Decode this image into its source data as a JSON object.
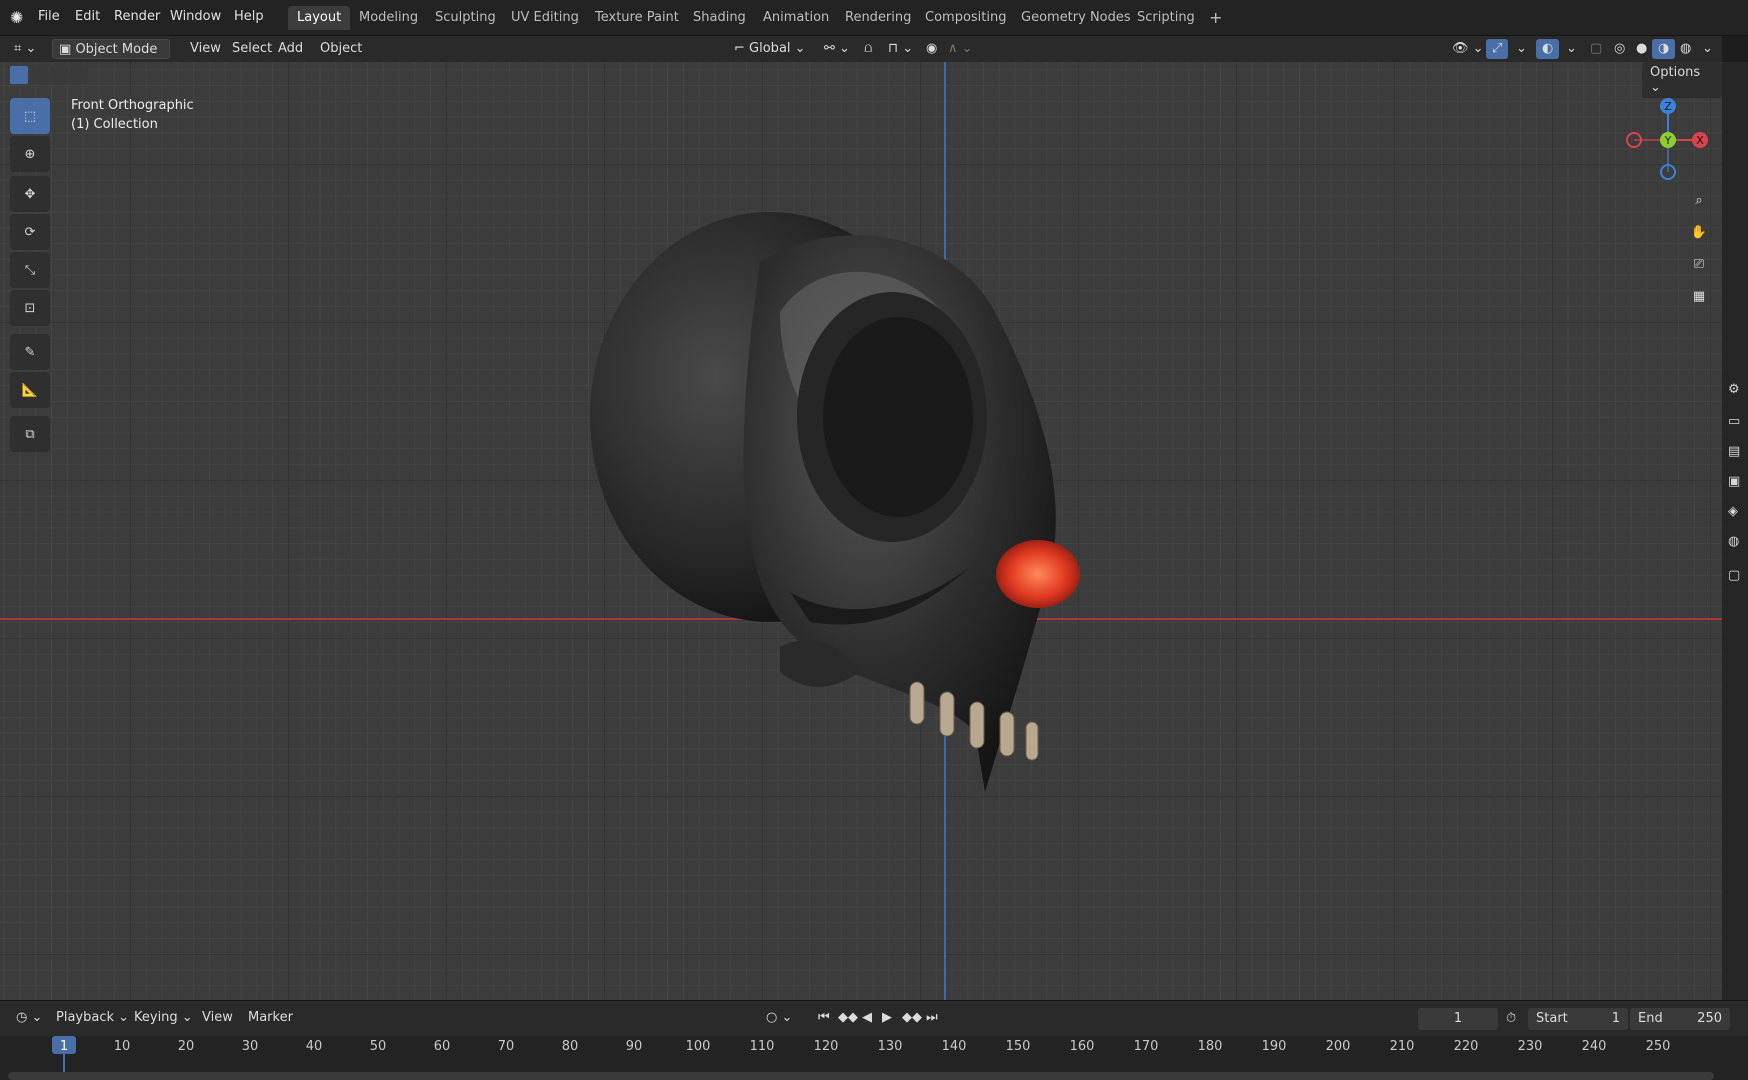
{
  "app": {
    "accent": "#4a6fa8"
  },
  "topbar": {
    "menus": [
      "File",
      "Edit",
      "Render",
      "Window",
      "Help"
    ],
    "workspaces": [
      "Layout",
      "Modeling",
      "Sculpting",
      "UV Editing",
      "Texture Paint",
      "Shading",
      "Animation",
      "Rendering",
      "Compositing",
      "Geometry Nodes",
      "Scripting"
    ],
    "add_tab": "+"
  },
  "header3d": {
    "mode": "Object Mode",
    "menus": [
      "View",
      "Select",
      "Add",
      "Object"
    ],
    "orientation": "Global",
    "options": "Options"
  },
  "viewport": {
    "view_name": "Front Orthographic",
    "collection": "(1) Collection",
    "gizmo": {
      "z": "Z",
      "y": "Y",
      "x": "X"
    }
  },
  "timeline": {
    "menus": [
      "Playback",
      "Keying",
      "View",
      "Marker"
    ],
    "current_frame": "1",
    "start_label": "Start",
    "start_value": "1",
    "end_label": "End",
    "end_value": "250",
    "ruler": [
      "1",
      "10",
      "20",
      "30",
      "40",
      "50",
      "60",
      "70",
      "80",
      "90",
      "100",
      "110",
      "120",
      "130",
      "140",
      "150",
      "160",
      "170",
      "180",
      "190",
      "200",
      "210",
      "220",
      "230",
      "240",
      "250"
    ]
  }
}
